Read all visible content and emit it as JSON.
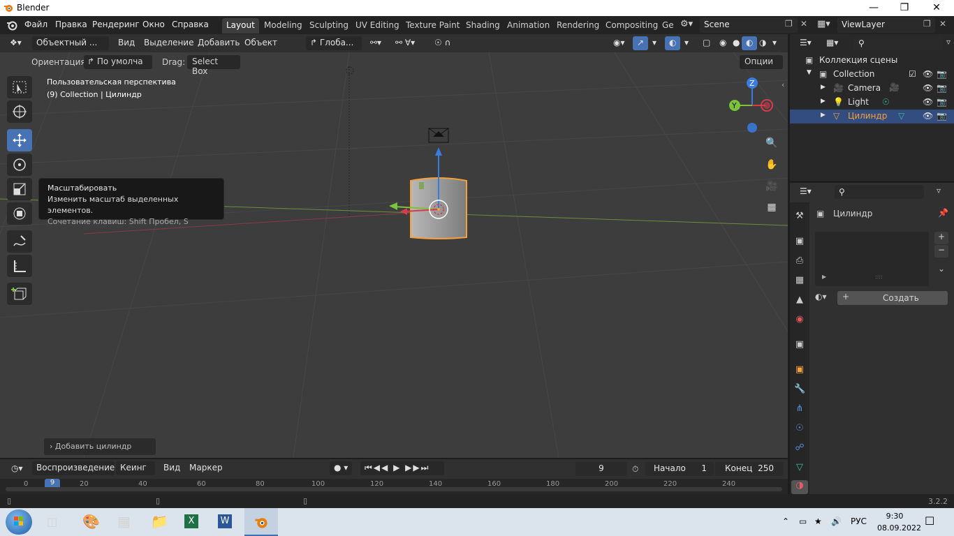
{
  "window": {
    "title": "Blender"
  },
  "menu": [
    "Файл",
    "Правка",
    "Рендеринг",
    "Окно",
    "Справка"
  ],
  "workspaces": [
    "Layout",
    "Modeling",
    "Sculpting",
    "UV Editing",
    "Texture Paint",
    "Shading",
    "Animation",
    "Rendering",
    "Compositing",
    "Ge"
  ],
  "scene": {
    "name": "Scene",
    "view_layer": "ViewLayer"
  },
  "viewport_header": {
    "mode": "Объектный ...",
    "menus": [
      "Вид",
      "Выделение",
      "Добавить",
      "Объект"
    ],
    "transform_orientation": "Глоба..."
  },
  "tool_settings": {
    "orientation_label": "Ориентация:",
    "orientation_value": "По умолча",
    "drag_label": "Drag:",
    "drag_value": "Select Box",
    "options": "Опции"
  },
  "viewport_overlay": {
    "perspective": "Пользовательская перспектива",
    "object_info": "(9) Collection | Цилиндр"
  },
  "tooltip": {
    "title": "Масштабировать",
    "description": "Изменить масштаб выделенных элементов.",
    "shortcut": "Сочетание клавиш: Shift Пробел, S"
  },
  "redo_panel": "Добавить цилиндр",
  "gizmo": {
    "z": "Z",
    "y": "Y"
  },
  "timeline": {
    "playback": "Воспроизведение",
    "keying": "Кеинг",
    "view": "Вид",
    "marker": "Маркер",
    "current_frame": "9",
    "start_label": "Начало",
    "start_value": "1",
    "end_label": "Конец",
    "end_value": "250",
    "ticks": [
      "0",
      "9",
      "20",
      "40",
      "60",
      "80",
      "100",
      "120",
      "140",
      "160",
      "180",
      "200",
      "220",
      "240"
    ]
  },
  "outliner": {
    "root": "Коллекция сцены",
    "collection": "Collection",
    "items": [
      "Camera",
      "Light",
      "Цилиндр"
    ]
  },
  "properties": {
    "object_name": "Цилиндр",
    "new_button": "Создать"
  },
  "status": {
    "version": "3.2.2"
  },
  "taskbar": {
    "language": "РУС",
    "time": "9:30",
    "date": "08.09.2022"
  },
  "colors": {
    "selection": "#4772b3",
    "object_outline": "#f5a23c",
    "x_axis": "#d63b4e",
    "y_axis": "#7ac33a",
    "z_axis": "#3a7be0"
  }
}
